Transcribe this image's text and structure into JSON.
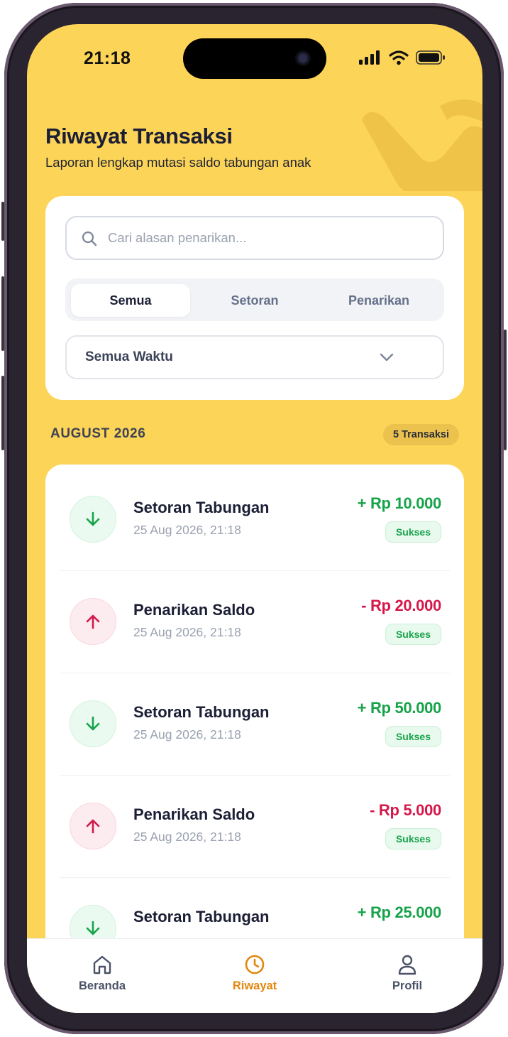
{
  "status_bar": {
    "time": "21:18"
  },
  "header": {
    "title": "Riwayat Transaksi",
    "subtitle": "Laporan lengkap mutasi saldo tabungan anak"
  },
  "search": {
    "placeholder": "Cari alasan penarikan...",
    "value": ""
  },
  "filter_tabs": [
    {
      "label": "Semua",
      "active": true
    },
    {
      "label": "Setoran",
      "active": false
    },
    {
      "label": "Penarikan",
      "active": false
    }
  ],
  "time_filter": {
    "selected": "Semua Waktu"
  },
  "month_group": {
    "label": "AUGUST 2026",
    "count_label": "5 Transaksi"
  },
  "transactions": [
    {
      "type": "in",
      "title": "Setoran Tabungan",
      "date": "25 Aug 2026, 21:18",
      "amount": "+ Rp 10.000",
      "status": "Sukses"
    },
    {
      "type": "out",
      "title": "Penarikan Saldo",
      "date": "25 Aug 2026, 21:18",
      "amount": "- Rp 20.000",
      "status": "Sukses"
    },
    {
      "type": "in",
      "title": "Setoran Tabungan",
      "date": "25 Aug 2026, 21:18",
      "amount": "+ Rp 50.000",
      "status": "Sukses"
    },
    {
      "type": "out",
      "title": "Penarikan Saldo",
      "date": "25 Aug 2026, 21:18",
      "amount": "- Rp 5.000",
      "status": "Sukses"
    },
    {
      "type": "in",
      "title": "Setoran Tabungan",
      "date": "",
      "amount": "+ Rp 25.000",
      "status": ""
    }
  ],
  "bottom_nav": [
    {
      "label": "Beranda",
      "icon": "home-icon",
      "active": false
    },
    {
      "label": "Riwayat",
      "icon": "clock-icon",
      "active": true
    },
    {
      "label": "Profil",
      "icon": "user-icon",
      "active": false
    }
  ],
  "colors": {
    "background": "#fcd457",
    "accent": "#e2860e",
    "deposit": "#17a34a",
    "withdrawal": "#d5184a",
    "text_primary": "#1b1e35"
  }
}
